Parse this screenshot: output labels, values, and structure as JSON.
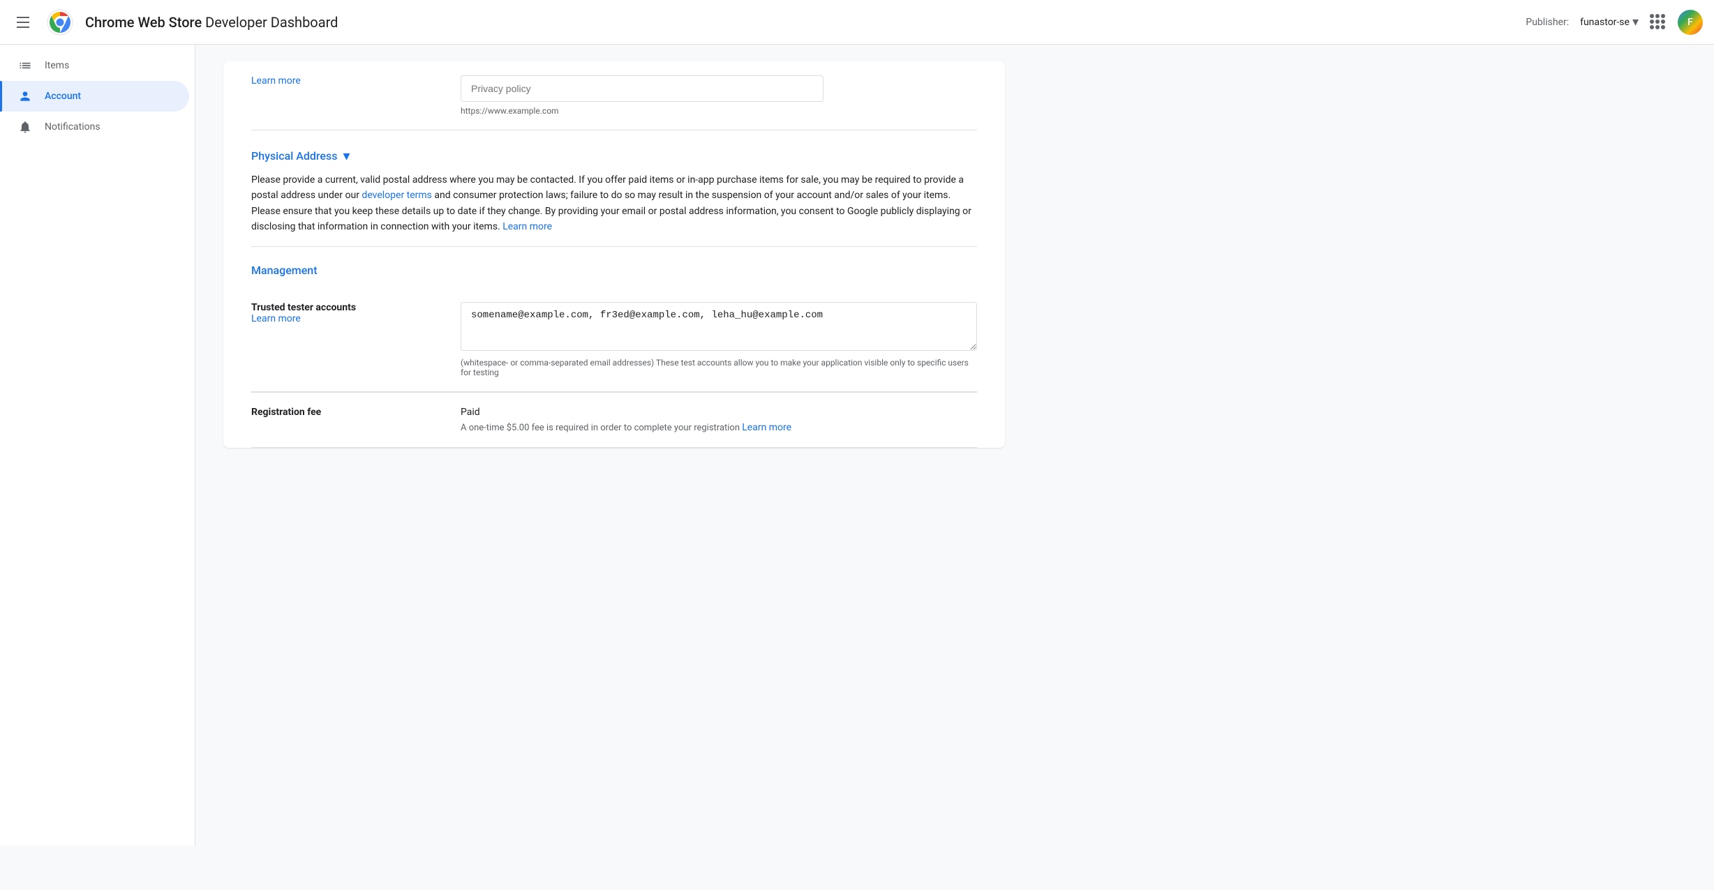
{
  "header": {
    "hamburger_label": "Menu",
    "app_title_bold": "Chrome Web Store",
    "app_title_regular": " Developer Dashboard",
    "publisher_label": "Publisher:",
    "publisher_name": "funastor-se",
    "avatar_initials": "F"
  },
  "sidebar": {
    "items": [
      {
        "id": "items",
        "label": "Items",
        "icon": "☁"
      },
      {
        "id": "account",
        "label": "Account",
        "icon": "👤",
        "active": true
      },
      {
        "id": "notifications",
        "label": "Notifications",
        "icon": "🔔"
      }
    ]
  },
  "main": {
    "privacy_policy": {
      "learn_more_label": "Learn more",
      "placeholder": "Privacy policy",
      "helper_text": "https://www.example.com"
    },
    "physical_address": {
      "section_title": "Physical Address",
      "description_before_link": "Please provide a current, valid postal address where you may be contacted. If you offer paid items or in-app purchase items for sale, you may be required to provide a postal address under our ",
      "link_text": "developer terms",
      "description_after_link": " and consumer protection laws; failure to do so may result in the suspension of your account and/or sales of your items. Please ensure that you keep these details up to date if they change. By providing your email or postal address information, you consent to Google publicly displaying or disclosing that information in connection with your items. ",
      "learn_more_label": "Learn more"
    },
    "management": {
      "section_title": "Management",
      "trusted_tester": {
        "label": "Trusted tester accounts",
        "learn_more_label": "Learn more",
        "value": "somename@example.com, fr3ed@example.com, leha_hu@example.com",
        "helper_text": "(whitespace- or comma-separated email addresses) These test accounts allow you to make your application visible only to specific users for testing"
      },
      "registration_fee": {
        "label": "Registration fee",
        "value": "Paid",
        "helper_text_before_link": "A one-time $5.00 fee is required in order to complete your registration ",
        "learn_more_label": "Learn more"
      }
    }
  }
}
